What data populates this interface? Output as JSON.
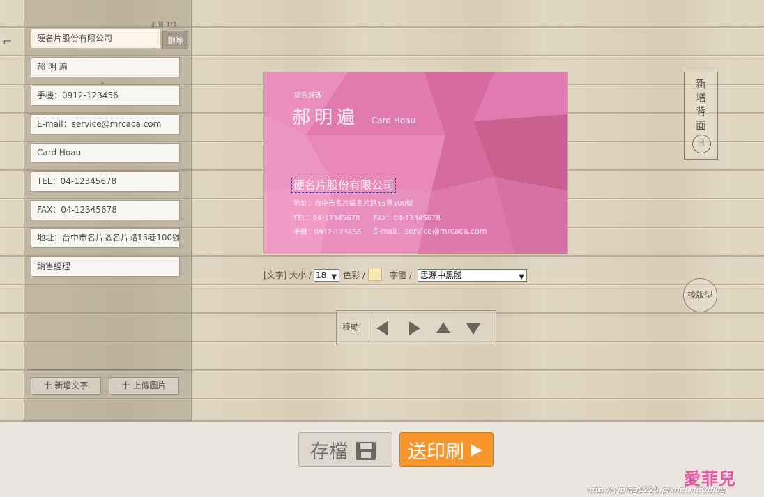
{
  "left_panel": {
    "page_indicator": "正面 1/1",
    "delete_label": "刪除",
    "fields": [
      "硬名片股份有限公司",
      "郝 明 遍",
      "手機：0912-123456",
      "E-mail：service@mrcaca.com",
      "Card Hoau",
      "TEL：04-12345678",
      "FAX：04-12345678",
      "地址：台中市名片區名片路15巷100號",
      "銷售經理"
    ],
    "add_text_label": "十 新增文字",
    "upload_image_label": "十 上傳圖片"
  },
  "card": {
    "title": "銷售經理",
    "name": "郝明遍",
    "english_name": "Card Hoau",
    "company": "硬名片股份有限公司",
    "address": "地址：台中市名片區名片路15巷100號",
    "tel": "TEL：04-12345678",
    "fax": "FAX：04-12345678",
    "mobile": "手機：0912-123456",
    "email": "E-mail：service@mrcaca.com",
    "background_color": "#e57db0"
  },
  "text_toolbar": {
    "text_size_label": "[文字] 大小 /",
    "size_value": "18",
    "color_label": "色彩 /",
    "color_value": "#fbe6b3",
    "font_label": "字體 /",
    "font_value": "思源中黑體"
  },
  "move_panel": {
    "label": "移動",
    "arrows": [
      "left-arrow-icon",
      "right-arrow-icon",
      "up-arrow-icon",
      "down-arrow-icon"
    ]
  },
  "side": {
    "add_back_label": [
      "新",
      "增",
      "背",
      "面"
    ],
    "change_layout_label": "換版型"
  },
  "bottom": {
    "save_label": "存檔",
    "print_label": "送印刷"
  },
  "watermark": {
    "logo": "愛菲兒",
    "url": "http://yiping1228.pixnet.net/blog"
  }
}
